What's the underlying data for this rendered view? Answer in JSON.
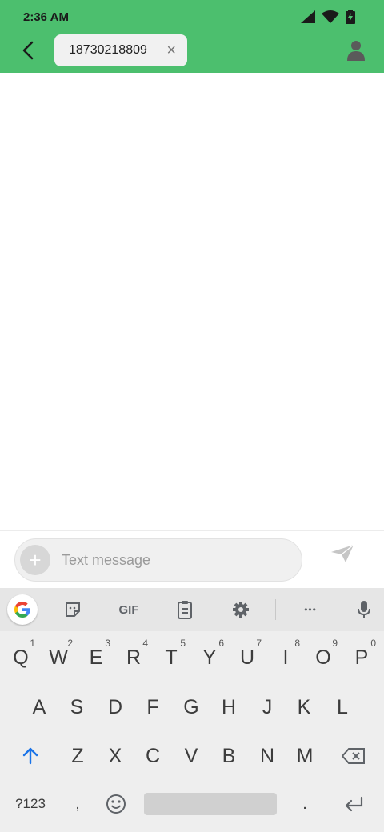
{
  "status_bar": {
    "time": "2:36 AM"
  },
  "header": {
    "recipient_chip": "18730218809",
    "chip_remove_glyph": "×"
  },
  "composer": {
    "placeholder": "Text message",
    "add_glyph": "+"
  },
  "keyboard": {
    "toolbar": {
      "gif_label": "GIF",
      "more_glyph": "•••"
    },
    "row1": [
      {
        "k": "Q",
        "h": "1"
      },
      {
        "k": "W",
        "h": "2"
      },
      {
        "k": "E",
        "h": "3"
      },
      {
        "k": "R",
        "h": "4"
      },
      {
        "k": "T",
        "h": "5"
      },
      {
        "k": "Y",
        "h": "6"
      },
      {
        "k": "U",
        "h": "7"
      },
      {
        "k": "I",
        "h": "8"
      },
      {
        "k": "O",
        "h": "9"
      },
      {
        "k": "P",
        "h": "0"
      }
    ],
    "row2": [
      "A",
      "S",
      "D",
      "F",
      "G",
      "H",
      "J",
      "K",
      "L"
    ],
    "row3": [
      "Z",
      "X",
      "C",
      "V",
      "B",
      "N",
      "M"
    ],
    "row4": {
      "symbols": "?123",
      "comma": ",",
      "period": "."
    }
  },
  "colors": {
    "header_green": "#4cbf6e",
    "shift_blue": "#1a73e8"
  }
}
